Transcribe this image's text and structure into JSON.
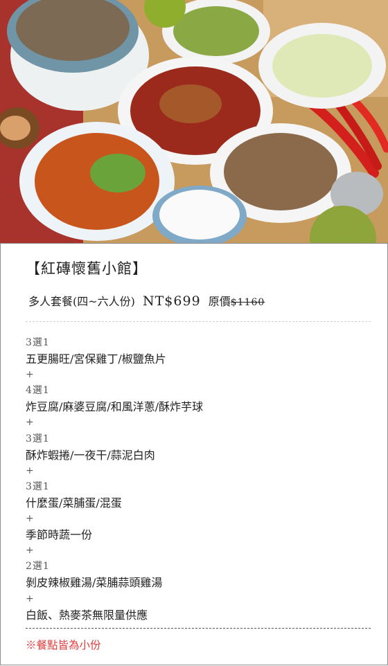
{
  "photo": {
    "alt_icon": "food-photo"
  },
  "header": {
    "title": "【紅磚懷舊小館】",
    "set_name": "多人套餐(四~六人份)",
    "price": "NT$699",
    "original_label": "原價",
    "original_price": "$1160"
  },
  "menu": [
    {
      "label": "3選1",
      "dishes": "五更腸旺/宮保雞丁/椒鹽魚片"
    },
    {
      "label": "4選1",
      "dishes": "炸豆腐/麻婆豆腐/和風洋蔥/酥炸芋球"
    },
    {
      "label": "3選1",
      "dishes": "酥炸蝦捲/一夜干/蒜泥白肉"
    },
    {
      "label": "3選1",
      "dishes": "什麼蛋/菜脯蛋/混蛋"
    },
    {
      "label": "",
      "dishes": "季節時蔬一份"
    },
    {
      "label": "2選1",
      "dishes": "剝皮辣椒雞湯/菜脯蒜頭雞湯"
    },
    {
      "label": "",
      "dishes": "白飯、熱麥茶無限量供應"
    }
  ],
  "plus": "+",
  "note": "※餐點皆為小份",
  "colors": {
    "note": "#e03a3a",
    "border": "#8c8c8c"
  }
}
